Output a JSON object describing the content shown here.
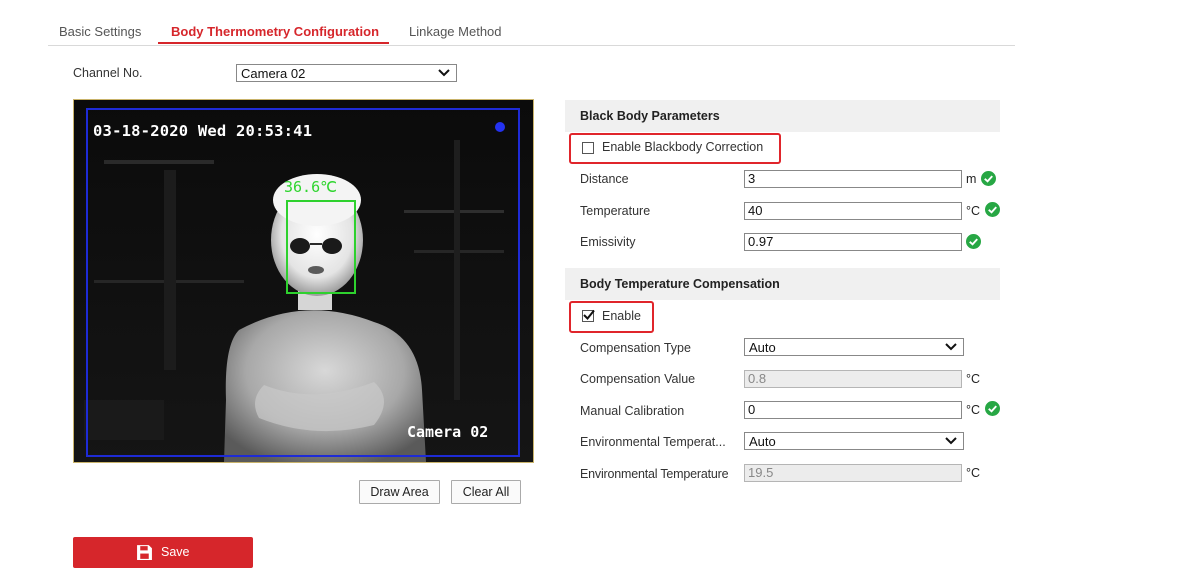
{
  "tabs": [
    {
      "label": "Basic Settings"
    },
    {
      "label": "Body Thermometry Configuration"
    },
    {
      "label": "Linkage Method"
    }
  ],
  "channel": {
    "label": "Channel No.",
    "value": "Camera 02"
  },
  "video": {
    "timestamp": "03-18-2020 Wed 20:53:41",
    "camera_label": "Camera 02",
    "face_temperature": "36.6℃"
  },
  "buttons": {
    "draw_area": "Draw Area",
    "clear_all": "Clear All",
    "save": "Save"
  },
  "black_body": {
    "title": "Black Body Parameters",
    "enable_label": "Enable Blackbody Correction",
    "enabled": false,
    "distance": {
      "label": "Distance",
      "value": "3",
      "unit": "m"
    },
    "temperature": {
      "label": "Temperature",
      "value": "40",
      "unit": "°C"
    },
    "emissivity": {
      "label": "Emissivity",
      "value": "0.97",
      "unit": ""
    }
  },
  "compensation": {
    "title": "Body Temperature Compensation",
    "enable_label": "Enable",
    "enabled": true,
    "type": {
      "label": "Compensation Type",
      "value": "Auto"
    },
    "value": {
      "label": "Compensation Value",
      "value": "0.8",
      "unit": "°C"
    },
    "manual_calibration": {
      "label": "Manual Calibration",
      "value": "0",
      "unit": "°C"
    },
    "env_temp_mode": {
      "label": "Environmental Temperat...",
      "value": "Auto"
    },
    "env_temp": {
      "label": "Environmental Temperature",
      "value": "19.5",
      "unit": "°C"
    }
  },
  "colors": {
    "accent": "#d6262b",
    "ok": "#27a744",
    "highlight": "#e0252b"
  }
}
